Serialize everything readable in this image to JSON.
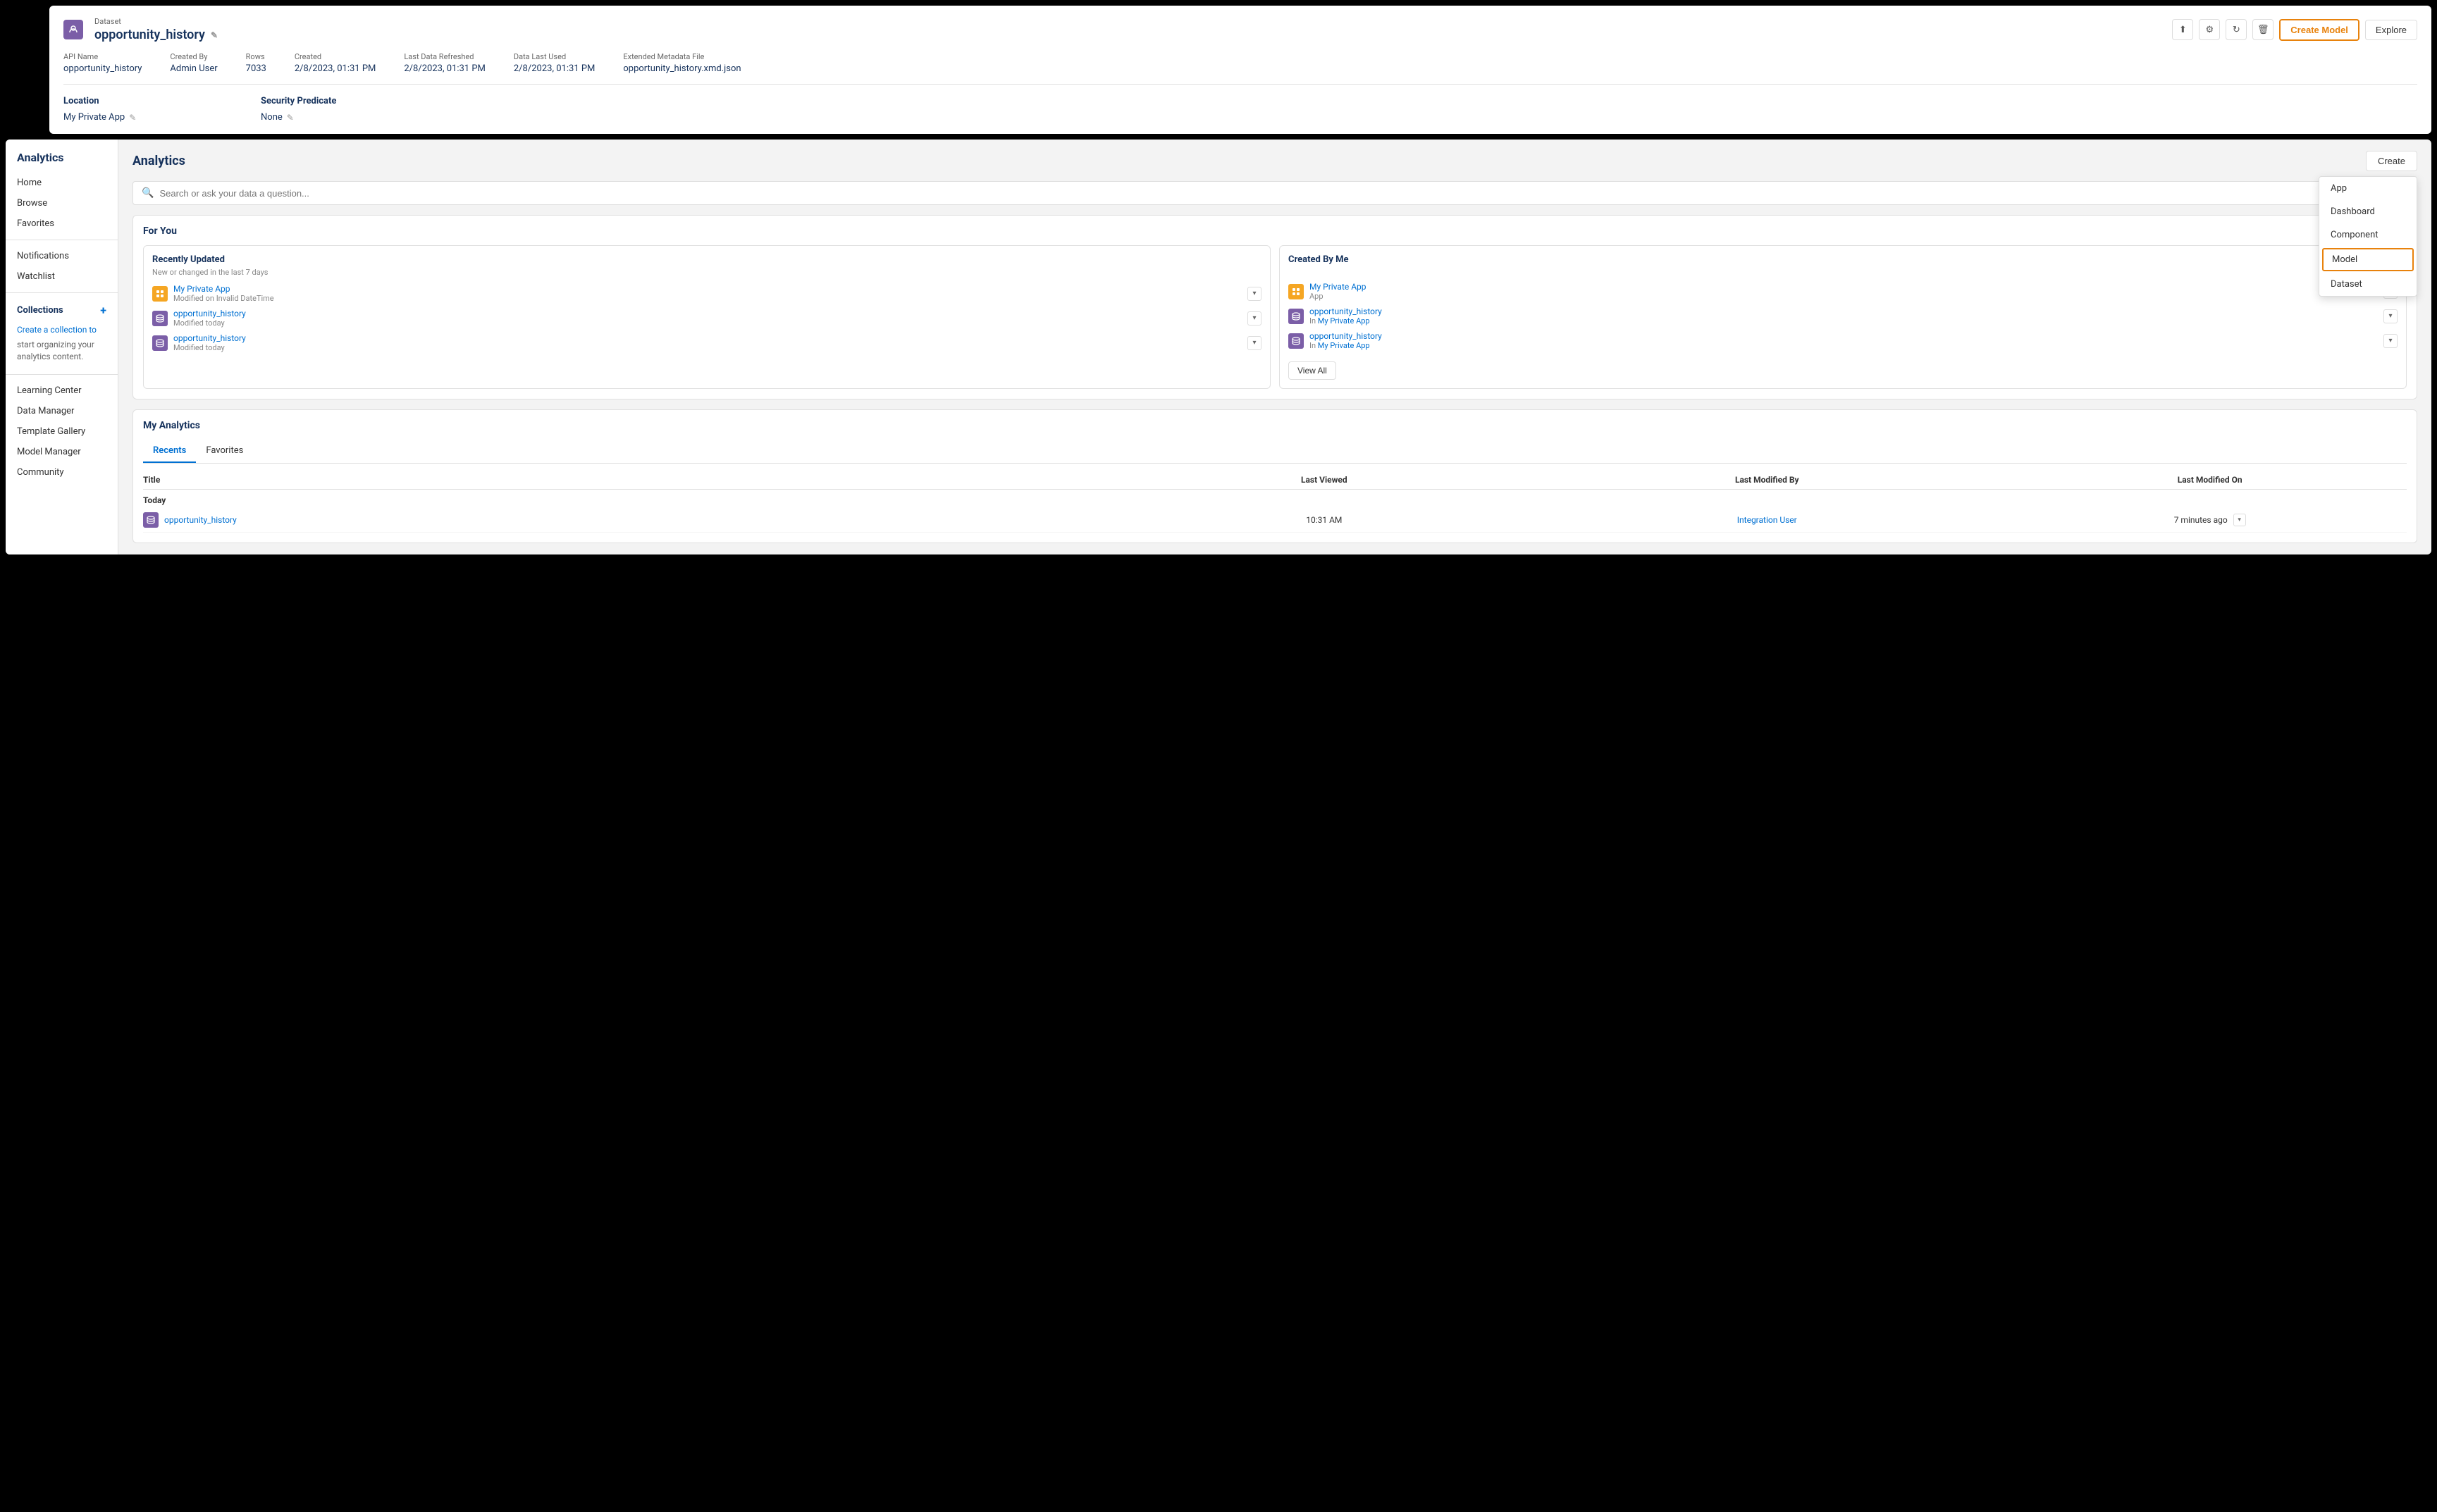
{
  "top_panel": {
    "dataset_label": "Dataset",
    "dataset_name": "opportunity_history",
    "edit_icon": "✎",
    "meta": {
      "api_name_label": "API Name",
      "api_name_value": "opportunity_history",
      "created_by_label": "Created By",
      "created_by_value": "Admin User",
      "rows_label": "Rows",
      "rows_value": "7033",
      "created_label": "Created",
      "created_value": "2/8/2023, 01:31 PM",
      "last_refreshed_label": "Last Data Refreshed",
      "last_refreshed_value": "2/8/2023, 01:31 PM",
      "data_last_used_label": "Data Last Used",
      "data_last_used_value": "2/8/2023, 01:31 PM",
      "extended_meta_label": "Extended Metadata File",
      "extended_meta_value": "opportunity_history.xmd.json"
    },
    "location_label": "Location",
    "location_value": "My Private App",
    "security_label": "Security Predicate",
    "security_value": "None",
    "actions": {
      "upload_icon": "⬆",
      "settings_icon": "⚙",
      "refresh_icon": "↻",
      "delete_icon": "🗑",
      "create_model_btn": "Create Model",
      "explore_btn": "Explore"
    }
  },
  "sidebar": {
    "title": "Analytics",
    "nav_items": [
      {
        "label": "Home",
        "id": "home"
      },
      {
        "label": "Browse",
        "id": "browse"
      },
      {
        "label": "Favorites",
        "id": "favorites"
      }
    ],
    "notifications_label": "Notifications",
    "watchlist_label": "Watchlist",
    "collections_title": "Collections",
    "collections_plus": "+",
    "collections_create_link": "Create a collection",
    "collections_desc_1": "to",
    "collections_desc_2": "start organizing your",
    "collections_desc_3": "analytics content.",
    "bottom_items": [
      {
        "label": "Learning Center",
        "id": "learning-center"
      },
      {
        "label": "Data Manager",
        "id": "data-manager"
      },
      {
        "label": "Template Gallery",
        "id": "template-gallery"
      },
      {
        "label": "Model Manager",
        "id": "model-manager"
      },
      {
        "label": "Community",
        "id": "community"
      }
    ]
  },
  "main": {
    "title": "Analytics",
    "create_btn": "Create",
    "search_placeholder": "Search or ask your data a question...",
    "for_you_title": "For You",
    "recently_updated_title": "Recently Updated",
    "recently_updated_subtitle": "New or changed in the last 7 days",
    "recently_updated_items": [
      {
        "icon_type": "orange",
        "name": "My Private App",
        "detail": "Modified on Invalid DateTime"
      },
      {
        "icon_type": "purple",
        "name": "opportunity_history",
        "detail": "Modified today"
      },
      {
        "icon_type": "purple",
        "name": "opportunity_history",
        "detail": "Modified today"
      }
    ],
    "created_by_me_title": "Created By Me",
    "created_by_me_items": [
      {
        "icon_type": "orange",
        "name": "My Private App",
        "sub_label": "App",
        "sub_link": null
      },
      {
        "icon_type": "purple",
        "name": "opportunity_history",
        "sub_label": "In ",
        "sub_link": "My Private App"
      },
      {
        "icon_type": "purple",
        "name": "opportunity_history",
        "sub_label": "In ",
        "sub_link": "My Private App"
      }
    ],
    "view_all_btn": "View All",
    "my_analytics_title": "My Analytics",
    "tabs": [
      {
        "label": "Recents",
        "active": true
      },
      {
        "label": "Favorites",
        "active": false
      }
    ],
    "table_headers": {
      "title": "Title",
      "last_viewed": "Last Viewed",
      "last_modified_by": "Last Modified By",
      "last_modified_on": "Last Modified On"
    },
    "table_group_today": "Today",
    "table_rows": [
      {
        "icon_type": "purple",
        "name": "opportunity_history",
        "last_viewed": "10:31 AM",
        "last_modified_by": "Integration User",
        "last_modified_on": "7 minutes ago"
      }
    ],
    "dropdown_menu": {
      "items": [
        {
          "label": "App",
          "highlighted": false
        },
        {
          "label": "Dashboard",
          "highlighted": false
        },
        {
          "label": "Component",
          "highlighted": false
        },
        {
          "label": "Model",
          "highlighted": true
        },
        {
          "label": "Dataset",
          "highlighted": false
        }
      ]
    }
  }
}
